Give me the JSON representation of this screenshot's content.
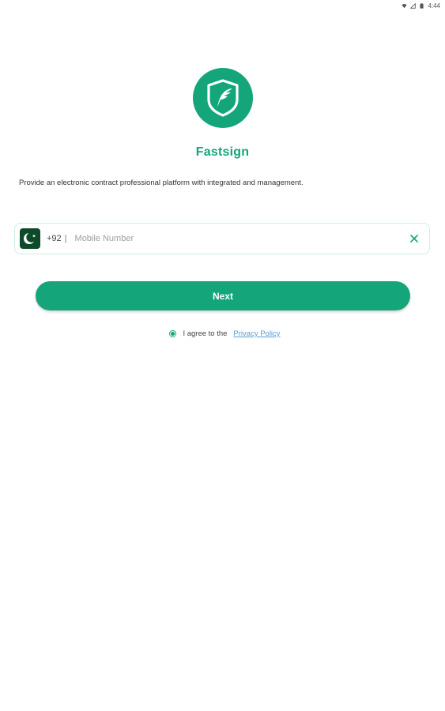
{
  "status_bar": {
    "time": "4:44",
    "icons": [
      "wifi-icon",
      "signal-icon",
      "battery-icon"
    ]
  },
  "app": {
    "name": "Fastsign",
    "tagline": "Provide an electronic contract professional platform with integrated and management.",
    "logo_icon": "fastsign-logo-icon"
  },
  "phone": {
    "country_flag_icon": "pakistan-flag-icon",
    "dial_code": "+92",
    "separator": "|",
    "placeholder": "Mobile Number",
    "value": "",
    "clear_icon": "close-icon"
  },
  "next_button": {
    "label": "Next"
  },
  "agreement": {
    "checked": true,
    "text": "I agree to the",
    "link_text": "Privacy Policy"
  },
  "colors": {
    "primary": "#14a67a",
    "field_border": "#cfeee2",
    "link": "#5b9bd5",
    "flag": "#0d4a2a"
  }
}
